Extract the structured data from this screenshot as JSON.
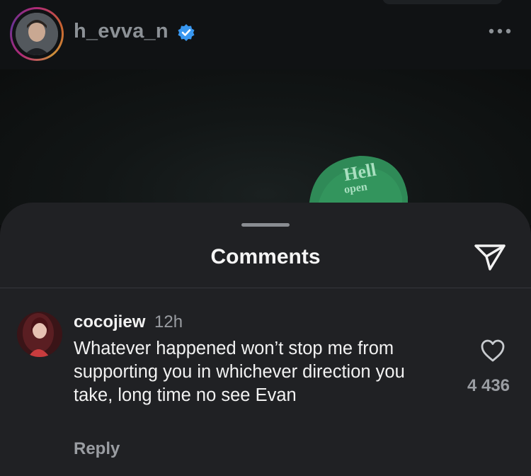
{
  "post": {
    "username": "h_evva_n",
    "verified": true,
    "avatar": "profile-photo",
    "more_icon": "more-horizontal-icon",
    "photo_cap_text": "Hell open"
  },
  "sheet": {
    "title": "Comments",
    "send_icon": "send-icon"
  },
  "comments": [
    {
      "username": "cocojiew",
      "time": "12h",
      "text": "Whatever happened won’t stop me from supporting you in whichever direction you take, long time no see Evan",
      "reply_label": "Reply",
      "like_icon": "heart-icon",
      "like_count": "4 436"
    }
  ],
  "colors": {
    "sheet_bg": "#202124",
    "verified_blue": "#3897f0",
    "text_primary": "#f2f2f2",
    "text_secondary": "#9a9da2"
  }
}
